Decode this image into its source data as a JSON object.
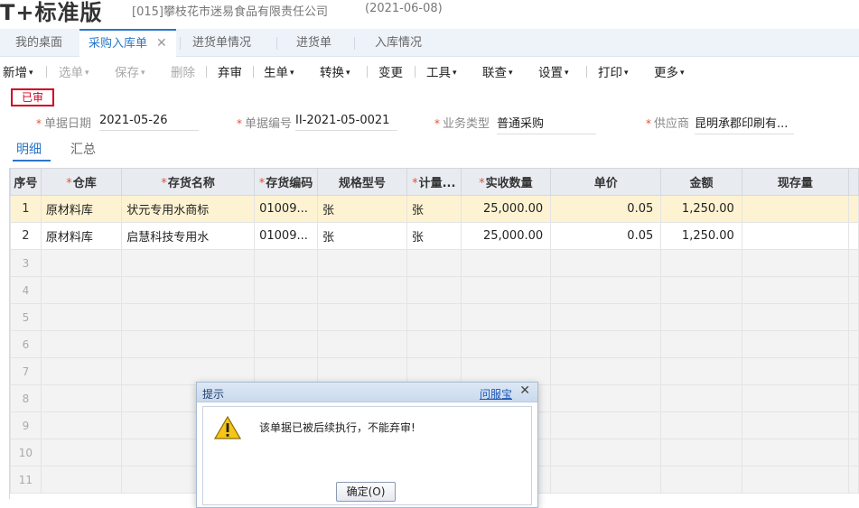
{
  "app": {
    "logo": "T+标准版",
    "company": "[015]攀枝花市迷易食品有限责任公司",
    "date": "(2021-06-08)"
  },
  "tabs": [
    {
      "label": "我的桌面"
    },
    {
      "label": "采购入库单",
      "close": "✕"
    },
    {
      "label": "进货单情况"
    },
    {
      "label": "进货单"
    },
    {
      "label": "入库情况"
    }
  ],
  "toolbar": {
    "new": "新增",
    "select": "选单",
    "save": "保存",
    "delete": "删除",
    "unaudit": "弃审",
    "generate": "生单",
    "convert": "转换",
    "change": "变更",
    "tools": "工具",
    "linked_query": "联查",
    "settings": "设置",
    "print": "打印",
    "more": "更多",
    "caret": "▾"
  },
  "status_stamp": "已审",
  "fields": {
    "req": "*",
    "doc_date_label": "单据日期",
    "doc_date": "2021-05-26",
    "doc_no_label": "单据编号",
    "doc_no": "II-2021-05-0021",
    "biz_type_label": "业务类型",
    "biz_type": "普通采购",
    "supplier_label": "供应商",
    "supplier": "昆明承郡印刷有..."
  },
  "subtabs": {
    "detail": "明细",
    "summary": "汇总"
  },
  "grid": {
    "headers": {
      "idx": "序号",
      "warehouse": "仓库",
      "item_name": "存货名称",
      "item_code": "存货编码",
      "spec": "规格型号",
      "unit": "计量...",
      "qty": "实收数量",
      "price": "单价",
      "amount": "金额",
      "stock": "现存量"
    },
    "rows": [
      {
        "idx": "1",
        "warehouse": "原材料库",
        "item_name": "状元专用水商标",
        "item_code": "01009...",
        "spec": "张",
        "unit": "张",
        "qty": "25,000.00",
        "price": "0.05",
        "amount": "1,250.00",
        "stock": ""
      },
      {
        "idx": "2",
        "warehouse": "原材料库",
        "item_name": "启慧科技专用水",
        "item_code": "01009...",
        "spec": "张",
        "unit": "张",
        "qty": "25,000.00",
        "price": "0.05",
        "amount": "1,250.00",
        "stock": ""
      }
    ],
    "empty_rows": [
      "3",
      "4",
      "5",
      "6",
      "7",
      "8",
      "9",
      "10",
      "11"
    ]
  },
  "dialog": {
    "title": "提示",
    "link": "问服宝",
    "close": "✕",
    "message": "该单据已被后续执行，不能弃审!",
    "ok_button": "确定(O)"
  },
  "colors": {
    "accent": "#2a77c9",
    "required": "#e0523b",
    "stamp": "#d0021b",
    "selected_row": "#fdf3d2"
  }
}
